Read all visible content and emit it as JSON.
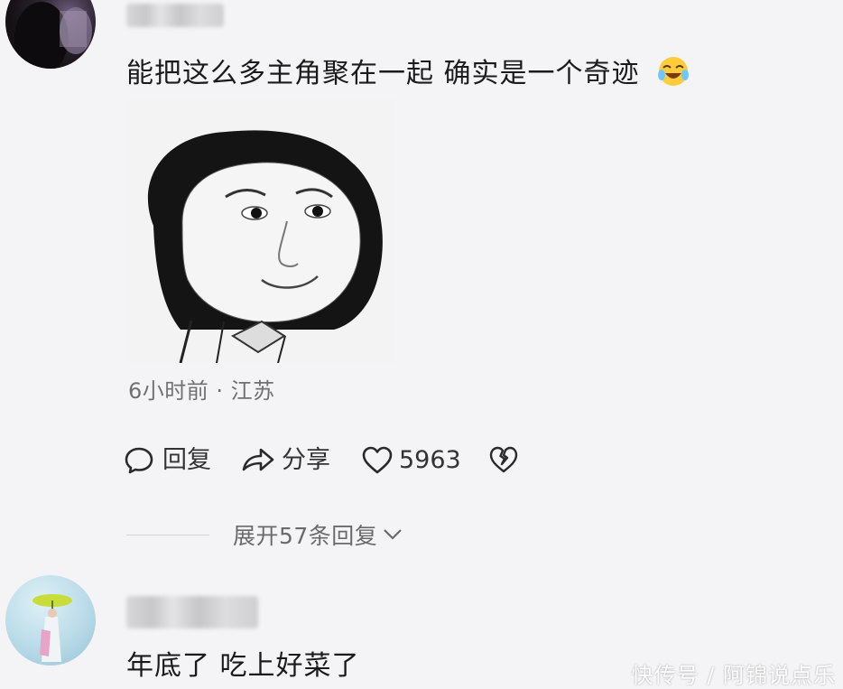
{
  "comment1": {
    "text": "能把这么多主角聚在一起 确实是一个奇迹",
    "emoji": "crying-laughing-emoji",
    "meta": "6小时前 · 江苏",
    "actions": {
      "reply_label": "回复",
      "share_label": "分享",
      "like_count": "5963",
      "dislike_icon": "broken-heart-icon"
    },
    "expand_label": "展开57条回复"
  },
  "comment2": {
    "text": "年底了 吃上好菜了"
  },
  "watermark": "快传号 / 阿锦说点乐",
  "colors": {
    "background": "#f4f4f6",
    "text": "#1b1b1b",
    "meta": "#707072"
  }
}
